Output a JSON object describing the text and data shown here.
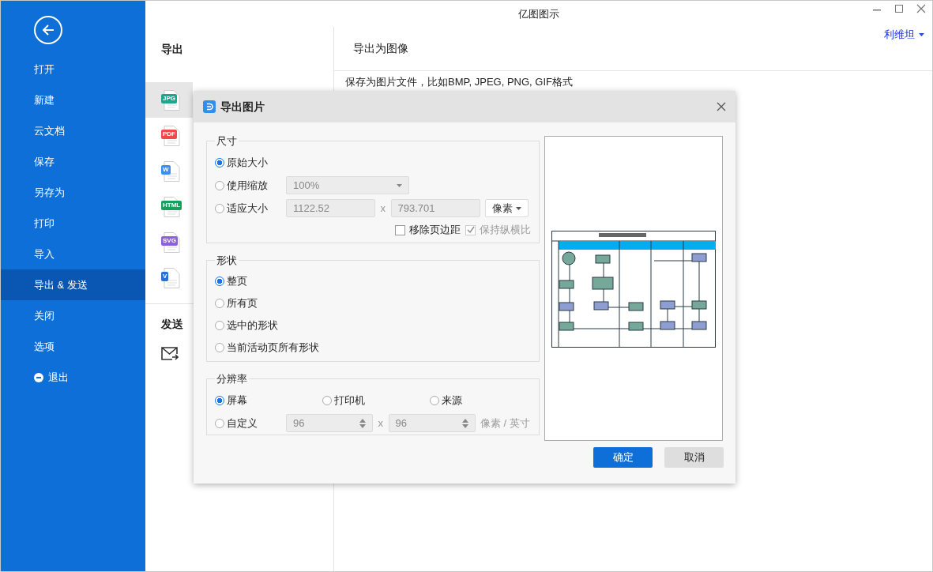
{
  "window": {
    "title": "亿图图示",
    "user": "利维坦"
  },
  "sidebar": {
    "items": [
      {
        "label": "打开",
        "selected": false,
        "kind": "plain"
      },
      {
        "label": "新建",
        "selected": false,
        "kind": "plain"
      },
      {
        "label": "云文档",
        "selected": false,
        "kind": "plain"
      },
      {
        "label": "保存",
        "selected": false,
        "kind": "plain"
      },
      {
        "label": "另存为",
        "selected": false,
        "kind": "plain"
      },
      {
        "label": "打印",
        "selected": false,
        "kind": "plain"
      },
      {
        "label": "导入",
        "selected": false,
        "kind": "plain"
      },
      {
        "label": "导出 & 发送",
        "selected": true,
        "kind": "plain"
      },
      {
        "label": "关闭",
        "selected": false,
        "kind": "plain"
      },
      {
        "label": "选项",
        "selected": false,
        "kind": "plain"
      },
      {
        "label": "退出",
        "selected": false,
        "kind": "exit"
      }
    ]
  },
  "export_panel": {
    "heading": "导出",
    "formats": [
      {
        "tag": "JPG",
        "color": "#1aa88c",
        "selected": true
      },
      {
        "tag": "PDF",
        "color": "#f0484d",
        "selected": false
      },
      {
        "tag": "W",
        "color": "#3a8ef5",
        "selected": false
      },
      {
        "tag": "HTML",
        "color": "#17a05d",
        "selected": false
      },
      {
        "tag": "SVG",
        "color": "#8c62dc",
        "selected": false
      },
      {
        "tag": "V",
        "color": "#2a6fd6",
        "selected": false
      }
    ],
    "send_heading": "发送"
  },
  "detail": {
    "heading": "导出为图像",
    "description": "保存为图片文件，比如BMP, JPEG, PNG, GIF格式"
  },
  "dialog": {
    "title": "导出图片",
    "size": {
      "legend": "尺寸",
      "options": [
        {
          "label": "原始大小",
          "selected": true
        },
        {
          "label": "使用缩放",
          "selected": false
        },
        {
          "label": "适应大小",
          "selected": false
        }
      ],
      "scale": {
        "value": "100%",
        "disabled": true
      },
      "width": {
        "value": "1122.52",
        "disabled": true
      },
      "times": "x",
      "height": {
        "value": "793.701",
        "disabled": true
      },
      "unit": "像素",
      "checkboxes": [
        {
          "label": "移除页边距",
          "checked": false,
          "disabled": false
        },
        {
          "label": "保持纵横比",
          "checked": true,
          "disabled": true
        }
      ]
    },
    "shape": {
      "legend": "形状",
      "options": [
        {
          "label": "整页",
          "selected": true
        },
        {
          "label": "所有页",
          "selected": false
        },
        {
          "label": "选中的形状",
          "selected": false
        },
        {
          "label": "当前活动页所有形状",
          "selected": false
        }
      ]
    },
    "resolution": {
      "legend": "分辨率",
      "options": [
        {
          "label": "屏幕",
          "selected": true
        },
        {
          "label": "打印机",
          "selected": false
        },
        {
          "label": "来源",
          "selected": false
        },
        {
          "label": "自定义",
          "selected": false
        }
      ],
      "dpi_x": {
        "value": "96",
        "disabled": true
      },
      "times": "x",
      "dpi_y": {
        "value": "96",
        "disabled": true
      },
      "unit": "像素 / 英寸"
    },
    "buttons": [
      {
        "label": "确定",
        "kind": "primary"
      },
      {
        "label": "取消",
        "kind": "secondary"
      }
    ]
  }
}
